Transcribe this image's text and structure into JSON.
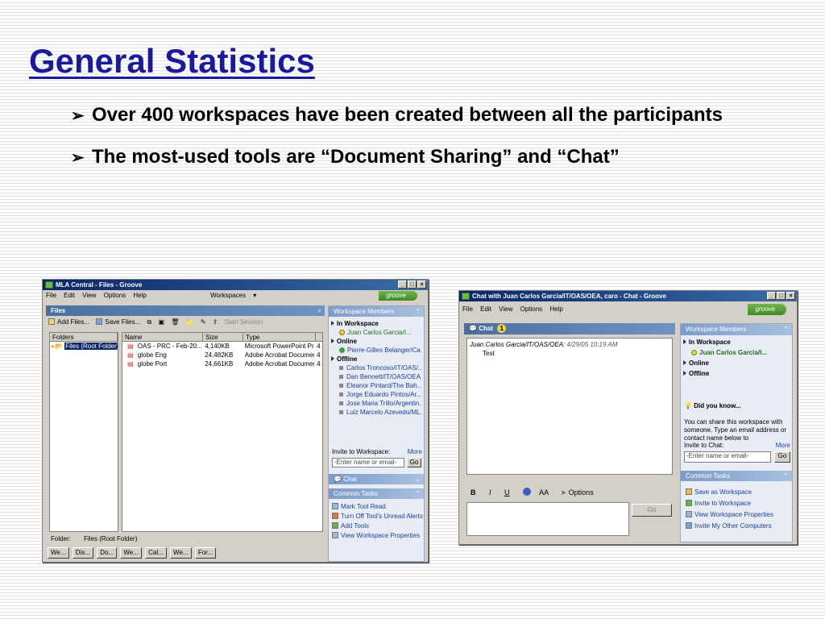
{
  "slide": {
    "title": "General Statistics",
    "bullets": [
      "Over 400 workspaces have been created between all the participants",
      "The most-used tools are “Document Sharing” and “Chat”"
    ]
  },
  "files_window": {
    "title": "MLA Central - Files - Groove",
    "menu": [
      "File",
      "Edit",
      "View",
      "Options",
      "Help"
    ],
    "workspaces_label": "Workspaces",
    "logo": "groove",
    "panel_title": "Files",
    "toolbar": {
      "add_files": "Add Files...",
      "save_files": "Save Files...",
      "start_session": "Start Session"
    },
    "folders_header": "Folders",
    "root_folder": "Files (Root Folder)",
    "columns": [
      "Name",
      "Size",
      "Type"
    ],
    "files": [
      {
        "name": "OAS - PRC - Feb-20...",
        "size": "4,140KB",
        "type": "Microsoft PowerPoint Pr...",
        "extra": "4"
      },
      {
        "name": "globe Eng",
        "size": "24,482KB",
        "type": "Adobe Acrobat Document",
        "extra": "4"
      },
      {
        "name": "globe Port",
        "size": "24,661KB",
        "type": "Adobe Acrobat Document",
        "extra": "4"
      }
    ],
    "folder_label": "Folder:",
    "folder_value": "Files (Root Folder)",
    "taskbar": [
      "We...",
      "Dis...",
      "Do...",
      "We...",
      "Cal...",
      "We...",
      "For..."
    ],
    "members": {
      "header": "Workspace Members",
      "in_workspace_label": "In Workspace",
      "in_workspace": [
        "Juan Carlos Garcia/I..."
      ],
      "online_label": "Online",
      "online": [
        "Pierre-Gilles Belanger/Ca..."
      ],
      "offline_label": "Offline",
      "offline": [
        "Carlos Troncoso/IT/OAS/...",
        "Dan Bennett/IT/OAS/OEA",
        "Eleanor Pintard/The Bah...",
        "Jorge Eduardo Pintos/Ar...",
        "Jose Maria Trillo/Argentin...",
        "Luiz Marcelo Azevedo/ML..."
      ],
      "invite_label": "Invite to Workspace:",
      "more": "More",
      "invite_placeholder": "-Enter name or email-",
      "go": "Go"
    },
    "chat_header": "Chat",
    "common_tasks": {
      "header": "Common Tasks",
      "items": [
        "Mark Tool Read",
        "Turn Off Tool's Unread Alerts",
        "Add Tools",
        "View Workspace Properties"
      ]
    }
  },
  "chat_window": {
    "title": "Chat with Juan Carlos Garcia/IT/OAS/OEA, caro - Chat - Groove",
    "menu": [
      "File",
      "Edit",
      "View",
      "Options",
      "Help"
    ],
    "logo": "groove",
    "panel_title": "Chat",
    "badge": "1",
    "message_author": "Juan Carlos Garcia/IT/OAS/OEA",
    "message_time": "4/29/05 10:19 AM",
    "message_text": "Test",
    "format": {
      "bold": "B",
      "italic": "I",
      "underline": "U",
      "size": "AA",
      "options": "Options"
    },
    "go": "Go",
    "members": {
      "header": "Workspace Members",
      "in_workspace_label": "In Workspace",
      "in_workspace": [
        "Juan Carlos Garcia/I..."
      ],
      "online_label": "Online",
      "offline_label": "Offline"
    },
    "did_you_know": {
      "title": "Did you know...",
      "text": "You can share this workspace with someone. Type an email address or contact name below to"
    },
    "invite": {
      "label": "Invite to Chat:",
      "more": "More",
      "placeholder": "-Enter name or email-",
      "go": "Go"
    },
    "common_tasks": {
      "header": "Common Tasks",
      "items": [
        "Save as Workspace",
        "Invite to Workspace",
        "View Workspace Properties",
        "Invite My Other Computers"
      ]
    }
  }
}
